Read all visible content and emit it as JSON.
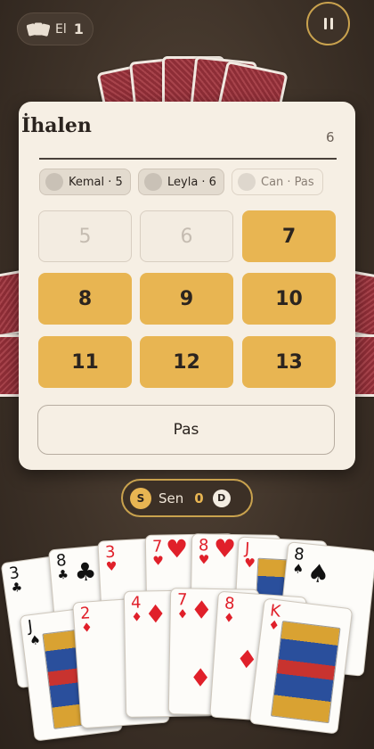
{
  "topbar": {
    "hand_label": "El",
    "hand_number": "1"
  },
  "modal": {
    "title": "İhalen",
    "count": "6",
    "bids": [
      {
        "label": "Kemal · 5",
        "state": "active"
      },
      {
        "label": "Leyla · 6",
        "state": "active"
      },
      {
        "label": "Can · Pas",
        "state": "passed"
      }
    ],
    "options": [
      {
        "value": "5",
        "enabled": false
      },
      {
        "value": "6",
        "enabled": false
      },
      {
        "value": "7",
        "enabled": true
      },
      {
        "value": "8",
        "enabled": true
      },
      {
        "value": "9",
        "enabled": true
      },
      {
        "value": "10",
        "enabled": true
      },
      {
        "value": "11",
        "enabled": true
      },
      {
        "value": "12",
        "enabled": true
      },
      {
        "value": "13",
        "enabled": true
      }
    ],
    "pass_label": "Pas"
  },
  "player": {
    "seat_badge": "S",
    "name": "Sen",
    "score": "0",
    "dealer_badge": "D"
  },
  "hand": {
    "row1": [
      {
        "rank": "3",
        "suit": "♣",
        "color": "black"
      },
      {
        "rank": "8",
        "suit": "♣",
        "color": "black"
      },
      {
        "rank": "3",
        "suit": "♥",
        "color": "red"
      },
      {
        "rank": "7",
        "suit": "♥",
        "color": "red"
      },
      {
        "rank": "8",
        "suit": "♥",
        "color": "red"
      },
      {
        "rank": "J",
        "suit": "♥",
        "color": "red"
      },
      {
        "rank": "8",
        "suit": "♠",
        "color": "black"
      }
    ],
    "row2": [
      {
        "rank": "J",
        "suit": "♠",
        "color": "black"
      },
      {
        "rank": "2",
        "suit": "♦",
        "color": "red"
      },
      {
        "rank": "4",
        "suit": "♦",
        "color": "red"
      },
      {
        "rank": "7",
        "suit": "♦",
        "color": "red"
      },
      {
        "rank": "8",
        "suit": "♦",
        "color": "red"
      },
      {
        "rank": "K",
        "suit": "♦",
        "color": "red"
      }
    ]
  }
}
